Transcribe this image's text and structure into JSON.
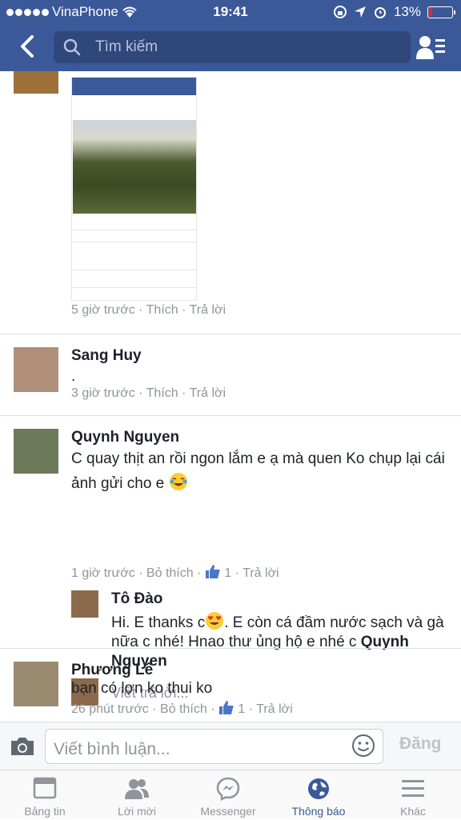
{
  "status_bar": {
    "carrier": "VinaPhone",
    "time": "19:41",
    "battery": "13%"
  },
  "header": {
    "search_placeholder": "Tìm kiếm"
  },
  "comments": [
    {
      "meta": "5 giờ trước · Thích · Trả lời"
    },
    {
      "name": "Sang Huy",
      "text": ".",
      "meta": "3 giờ trước · Thích · Trả lời"
    },
    {
      "name": "Quynh Nguyen",
      "text": "C quay thịt an rồi ngon lắm e ạ  mà quen Ko chụp lại cái ảnh gửi cho e",
      "meta_time": "1 giờ trước · Bỏ thích ·",
      "likes": "1",
      "meta_reply": "· Trả lời",
      "reply": {
        "name": "Tô Đào",
        "text": "Hi. E thanks c",
        "text2": ". E còn cá đầm nước sạch và gà nữa c nhé! Hnao thư ủng hộ e nhé c ",
        "mention": "Quynh Nguyen"
      },
      "reply_placeholder": "Viết trả lời..."
    },
    {
      "name": "Phương Lê",
      "text": "bạn có lợn ko thui ko",
      "meta_time": "26 phút trước · Bỏ thích ·",
      "likes": "1",
      "meta_reply": "· Trả lời"
    }
  ],
  "composer": {
    "placeholder": "Viết bình luận...",
    "post_label": "Đăng"
  },
  "tabs": [
    {
      "label": "Bảng tin",
      "icon": "news-feed-icon"
    },
    {
      "label": "Lời mời",
      "icon": "friend-requests-icon"
    },
    {
      "label": "Messenger",
      "icon": "messenger-icon"
    },
    {
      "label": "Thông báo",
      "icon": "notifications-globe-icon",
      "active": true
    },
    {
      "label": "Khác",
      "icon": "menu-icon"
    }
  ],
  "colors": {
    "brand": "#3b5998",
    "meta": "#90949c"
  }
}
